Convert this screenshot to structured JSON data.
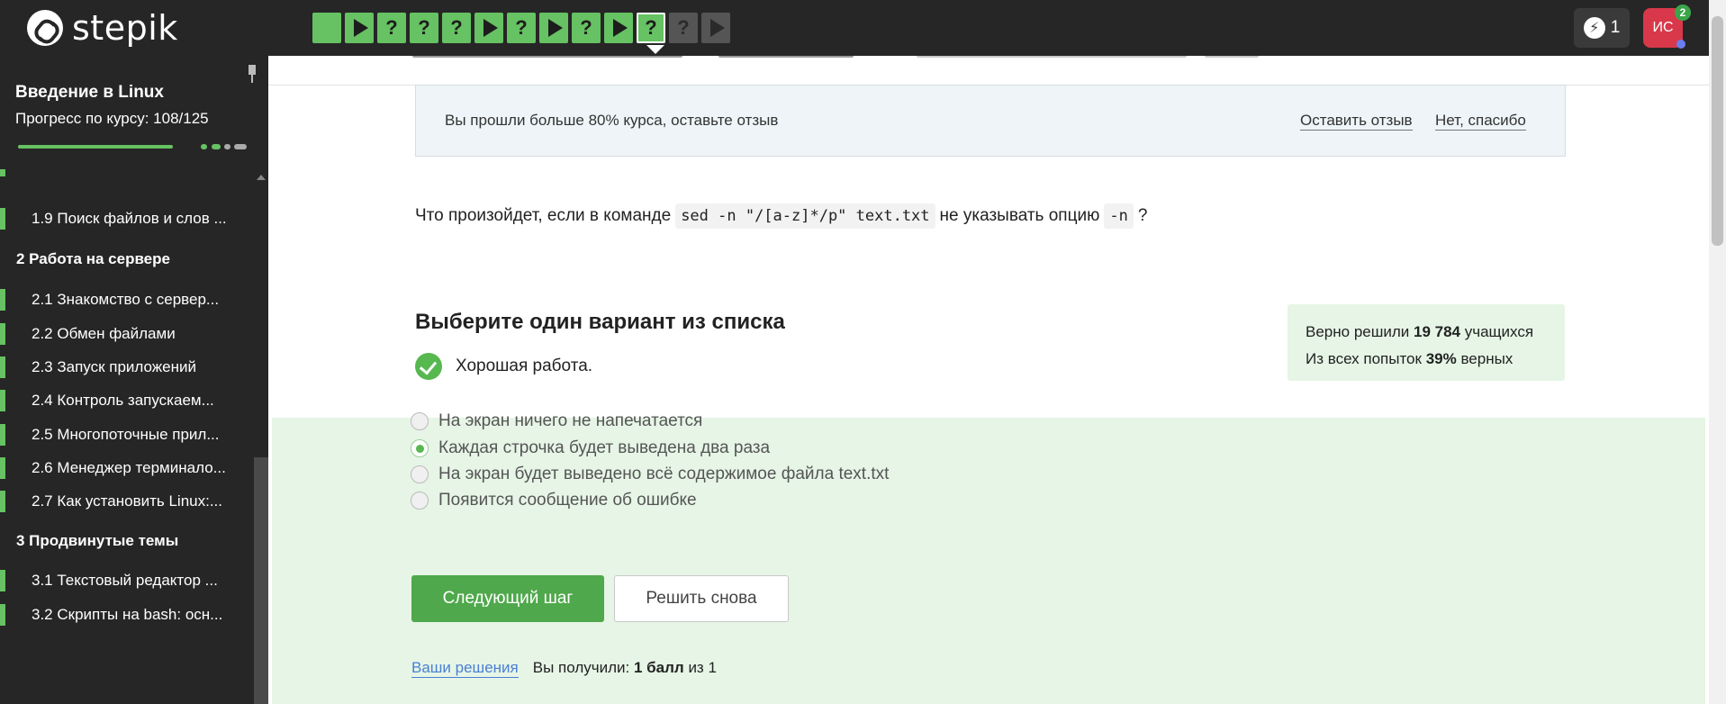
{
  "brand": {
    "name": "stepik"
  },
  "steps": [
    {
      "kind": "square",
      "state": "done"
    },
    {
      "kind": "play",
      "state": "done"
    },
    {
      "kind": "quiz",
      "label": "?",
      "state": "done"
    },
    {
      "kind": "quiz",
      "label": "?",
      "state": "done"
    },
    {
      "kind": "quiz",
      "label": "?",
      "state": "done"
    },
    {
      "kind": "play",
      "state": "done"
    },
    {
      "kind": "quiz",
      "label": "?",
      "state": "done"
    },
    {
      "kind": "play",
      "state": "done"
    },
    {
      "kind": "quiz",
      "label": "?",
      "state": "done"
    },
    {
      "kind": "play",
      "state": "done"
    },
    {
      "kind": "quiz",
      "label": "?",
      "state": "current"
    },
    {
      "kind": "quiz",
      "label": "?",
      "state": "todo"
    },
    {
      "kind": "play",
      "state": "todo"
    }
  ],
  "header": {
    "energy_count": "1",
    "avatar_initials": "ИС",
    "notifications_count": "2"
  },
  "sidebar": {
    "course_title": "Введение в Linux",
    "progress_label": "Прогресс по курсу:  108/125",
    "progress": {
      "done": 108,
      "total": 125
    },
    "items": [
      {
        "type": "lesson",
        "label": "1.9  Поиск файлов и слов ..."
      },
      {
        "type": "section",
        "label": "2  Работа на сервере"
      },
      {
        "type": "lesson",
        "label": "2.1  Знакомство с сервер..."
      },
      {
        "type": "lesson",
        "label": "2.2  Обмен файлами"
      },
      {
        "type": "lesson",
        "label": "2.3  Запуск приложений"
      },
      {
        "type": "lesson",
        "label": "2.4  Контроль запускаем..."
      },
      {
        "type": "lesson",
        "label": "2.5  Многопоточные прил..."
      },
      {
        "type": "lesson",
        "label": "2.6  Менеджер терминало..."
      },
      {
        "type": "lesson",
        "label": "2.7  Как установить Linux:..."
      },
      {
        "type": "section",
        "label": "3  Продвинутые темы"
      },
      {
        "type": "lesson",
        "label": "3.1  Текстовый редактор ..."
      },
      {
        "type": "lesson",
        "label": "3.2  Скрипты на bash: осн..."
      }
    ]
  },
  "feedback": {
    "text": "Вы прошли больше 80% курса, оставьте отзыв",
    "leave_review": "Оставить отзыв",
    "no_thanks": "Нет, спасибо"
  },
  "question": {
    "prefix": "Что произойдет, если в команде",
    "command": "sed -n \"/[a-z]*/p\" text.txt",
    "middle": "не указывать опцию",
    "option": "-n",
    "suffix": "?"
  },
  "quiz": {
    "title": "Выберите один вариант из списка",
    "result": "Хорошая работа.",
    "stats": {
      "solved_prefix": "Верно решили",
      "solved_count": "19 784",
      "solved_suffix": "учащихся",
      "attempts_prefix": "Из всех попыток",
      "attempts_percent": "39%",
      "attempts_suffix": "верных"
    },
    "options": [
      {
        "label": "На экран ничего не напечатается",
        "selected": false
      },
      {
        "label": "Каждая строчка будет выведена два раза",
        "selected": true
      },
      {
        "label": "На экран будет выведено всё содержимое файла text.txt",
        "selected": false
      },
      {
        "label": "Появится сообщение об ошибке",
        "selected": false
      }
    ],
    "next_button": "Следующий шаг",
    "retry_button": "Решить снова",
    "your_solutions": "Ваши решения",
    "score_prefix": "Вы получили:",
    "score_value": "1 балл",
    "score_of": "из",
    "score_max": "1"
  },
  "colors": {
    "accent": "#66c262",
    "topbar": "#262626",
    "avatar": "#d8384a",
    "answers_bg": "#e6f5e6"
  }
}
